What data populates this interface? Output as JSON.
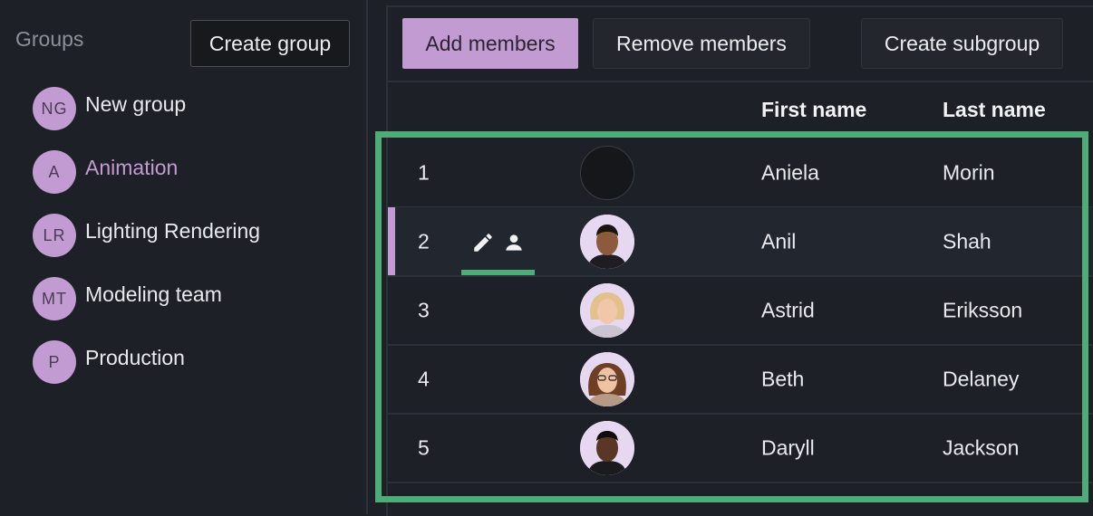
{
  "sidebar": {
    "title": "Groups",
    "create_label": "Create group",
    "groups": [
      {
        "initials": "NG",
        "label": "New group",
        "active": false
      },
      {
        "initials": "A",
        "label": "Animation",
        "active": true
      },
      {
        "initials": "LR",
        "label": "Lighting Rendering",
        "active": false
      },
      {
        "initials": "MT",
        "label": "Modeling team",
        "active": false
      },
      {
        "initials": "P",
        "label": "Production",
        "active": false
      }
    ]
  },
  "toolbar": {
    "add_label": "Add members",
    "remove_label": "Remove members",
    "subgroup_label": "Create subgroup"
  },
  "table": {
    "columns": {
      "first": "First name",
      "last": "Last name"
    },
    "rows": [
      {
        "num": "1",
        "first": "Aniela",
        "last": "Morin",
        "photo": "empty"
      },
      {
        "num": "2",
        "first": "Anil",
        "last": "Shah",
        "photo": "man-short-hair"
      },
      {
        "num": "3",
        "first": "Astrid",
        "last": "Eriksson",
        "photo": "woman-blonde"
      },
      {
        "num": "4",
        "first": "Beth",
        "last": "Delaney",
        "photo": "woman-glasses"
      },
      {
        "num": "5",
        "first": "Daryll",
        "last": "Jackson",
        "photo": "man-dark-hair"
      }
    ]
  },
  "colors": {
    "accent": "#c39bd3",
    "highlight": "#4ead77",
    "background": "#1d2026"
  }
}
